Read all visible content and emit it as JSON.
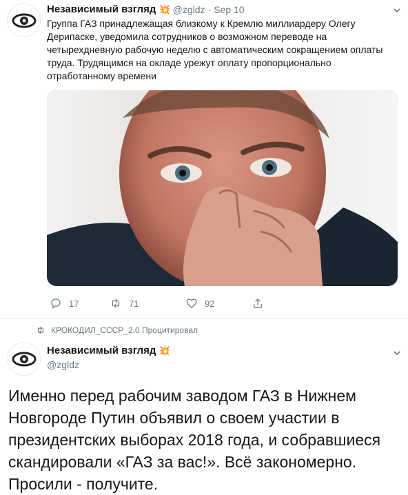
{
  "tweet1": {
    "author_name": "Независимый взгляд",
    "author_emoji": "💥",
    "handle": "@zgldz",
    "separator": "·",
    "date": "Sep 10",
    "text": "Группа ГАЗ принадлежащая близкому к Кремлю миллиардеру Олегу Дерипаске, уведомила сотрудников о возможном переводе на четырехдневную рабочую неделю с автоматическим сокращением оплаты труда. Трудящимся на окладе урежут оплату пропорционально отработанному времени",
    "image_alt": "photo of a man touching his nose",
    "replies": "17",
    "retweets": "71",
    "likes": "92"
  },
  "retweet_context": {
    "text": "КРОКОДИЛ_СССР_2.0 Процитировал"
  },
  "tweet2": {
    "author_name": "Независимый взгляд",
    "author_emoji": "💥",
    "handle": "@zgldz",
    "text": "Именно перед рабочим заводом ГАЗ в Нижнем Новгороде Путин объявил о своем участии в президентских выборах 2018 года, и собравшиеся скандировали «ГАЗ за вас!». Всё закономерно. Просили - получите."
  },
  "colors": {
    "text_primary": "#14171a",
    "text_secondary": "#657786",
    "divider": "#e6ecf0"
  }
}
